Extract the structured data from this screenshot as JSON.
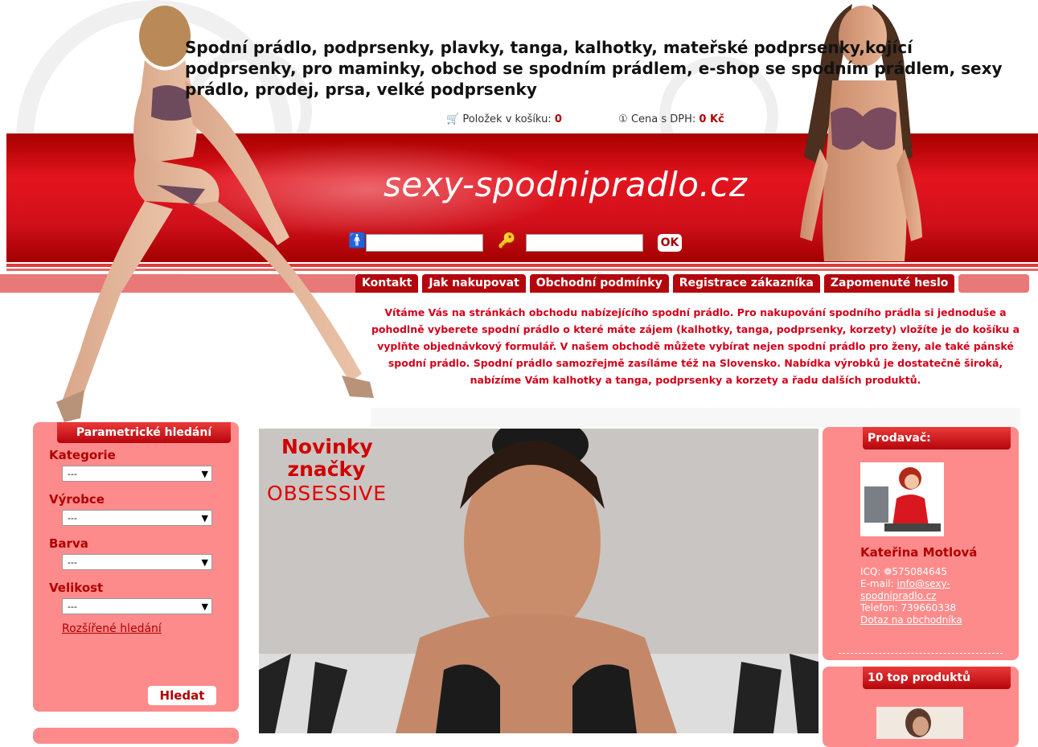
{
  "header": {
    "headline": "Spodní prádlo, podprsenky, plavky, tanga, kalhotky, mateřské podprsenky,kojící podprsenky, pro maminky, obchod se spodním prádlem, e-shop se spodním prádlem, sexy prádlo, prodej, prsa, velké podprsenky",
    "cart_label": "Položek v košíku:",
    "cart_count": "0",
    "price_label": "Cena s DPH:",
    "price_value": "0 Kč",
    "logo": "sexy-spodnipradlo.cz",
    "ok_label": "OK"
  },
  "menu": {
    "items": [
      "Kontakt",
      "Jak nakupovat",
      "Obchodní podmínky",
      "Registrace zákazníka",
      "Zapomenuté heslo"
    ]
  },
  "welcome": "Vítáme Vás na stránkách obchodu nabízejícího spodní prádlo. Pro nakupování spodního prádla si jednoduše a pohodlně vyberete spodní prádlo o které máte zájem (kalhotky, tanga, podprsenky, korzety) vložíte je do košíku a vyplňte objednávkový formulář. V našem obchodě můžete vybírat nejen spodní prádlo pro ženy, ale také pánské spodní prádlo. Spodní prádlo samozřejmě zasíláme též na Slovensko. Nabídka výrobků je dostatečně široká, nabízíme Vám kalhotky a tanga, podprsenky a korzety a řadu dalších produktů.",
  "search_panel": {
    "title": "Parametrické hledání",
    "filters": [
      {
        "label": "Kategorie",
        "value": "---"
      },
      {
        "label": "Výrobce",
        "value": "---"
      },
      {
        "label": "Barva",
        "value": "---"
      },
      {
        "label": "Velikost",
        "value": "---"
      }
    ],
    "advanced_link": "Rozšířené hledání",
    "search_button": "Hledat"
  },
  "banner": {
    "line1": "Novinky značky",
    "line2": "OBSESSIVE"
  },
  "seller": {
    "title": "Prodavač:",
    "name": "Kateřina Motlová",
    "icq_label": "ICQ:",
    "icq": "575084645",
    "email_label": "E-mail:",
    "email_1": "info@sexy-",
    "email_2": "spodnipradlo.cz",
    "phone": "Telefon: 739660338",
    "contact_link": "Dotaz na obchodníka"
  },
  "top_products": {
    "title": "10 top produktů"
  },
  "colors": {
    "accent_red": "#b3070d",
    "panel_pink": "#fe8b8b",
    "text_red": "#d2001a"
  }
}
